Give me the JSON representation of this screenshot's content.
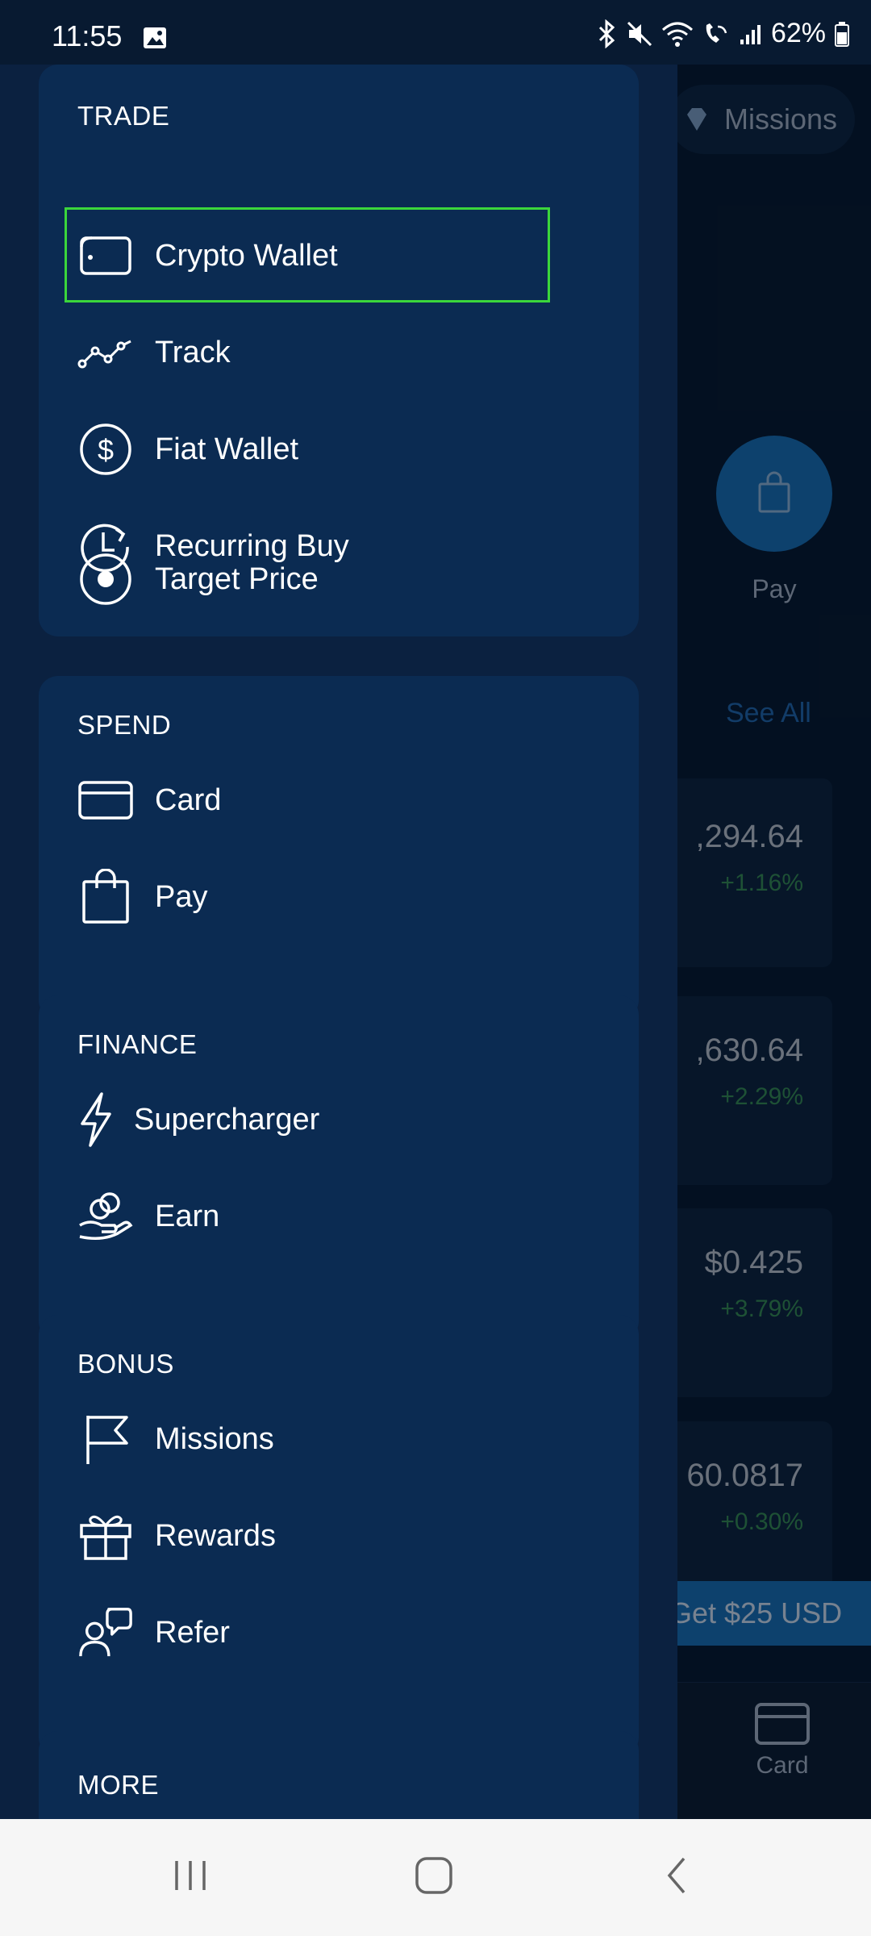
{
  "status_bar": {
    "time": "11:55",
    "battery": "62%"
  },
  "background": {
    "missions_label": "Missions",
    "pay_label": "Pay",
    "see_all": "See All",
    "rows": [
      {
        "price": ",294.64",
        "change": "+1.16%"
      },
      {
        "price": ",630.64",
        "change": "+2.29%"
      },
      {
        "price": "$0.425",
        "change": "+3.79%"
      },
      {
        "price": "60.0817",
        "change": "+0.30%"
      }
    ],
    "promo": "Get $25 USD",
    "bottom_nav_card": "Card"
  },
  "drawer": {
    "sections": [
      {
        "title": "TRADE",
        "items": [
          {
            "label": "Crypto Wallet",
            "icon": "wallet-icon"
          },
          {
            "label": "Track",
            "icon": "track-icon"
          },
          {
            "label": "Fiat Wallet",
            "icon": "dollar-icon"
          },
          {
            "label": "Recurring Buy",
            "icon": "recurring-icon"
          },
          {
            "label": "Target Price",
            "icon": "target-icon"
          }
        ]
      },
      {
        "title": "SPEND",
        "items": [
          {
            "label": "Card",
            "icon": "card-icon"
          },
          {
            "label": "Pay",
            "icon": "bag-icon"
          }
        ]
      },
      {
        "title": "FINANCE",
        "items": [
          {
            "label": "Supercharger",
            "icon": "lightning-icon"
          },
          {
            "label": "Earn",
            "icon": "earn-icon"
          }
        ]
      },
      {
        "title": "BONUS",
        "items": [
          {
            "label": "Missions",
            "icon": "flag-icon"
          },
          {
            "label": "Rewards",
            "icon": "gift-icon"
          },
          {
            "label": "Refer",
            "icon": "refer-icon"
          }
        ]
      },
      {
        "title": "MORE",
        "items": []
      }
    ]
  },
  "colors": {
    "drawer_bg": "#0b2140",
    "section_bg": "#0b2b52",
    "highlight": "#3bd63b",
    "accent": "#1565a8"
  }
}
